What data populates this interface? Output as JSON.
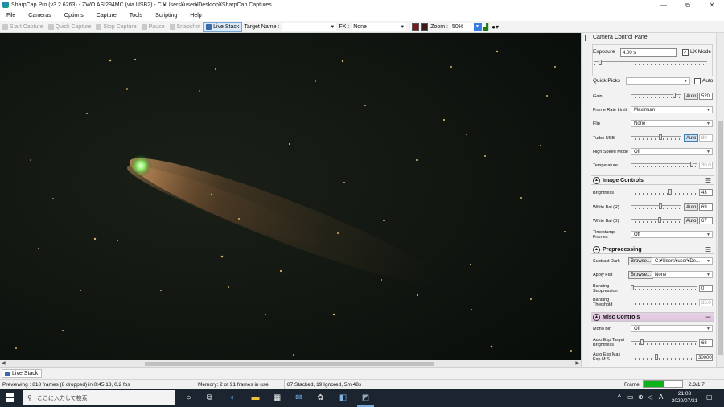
{
  "window": {
    "title": "SharpCap Pro (v3.2.6263) - ZWO ASI294MC (via USB2) - C:¥Users¥user¥Desktop¥SharpCap Captures",
    "minimize": "—",
    "maximize": "⧉",
    "close": "✕"
  },
  "menu": [
    "File",
    "Cameras",
    "Options",
    "Capture",
    "Tools",
    "Scripting",
    "Help"
  ],
  "toolbar": {
    "start_capture": "Start Capture",
    "quick_capture": "Quick Capture",
    "stop_capture": "Stop Capture",
    "pause": "Pause",
    "snapshot": "Snapshot",
    "live_stack": "Live Stack",
    "target_name_label": "Target Name :",
    "target_name_value": "",
    "fx_label": "FX :",
    "fx_value": "None",
    "zoom_label": "Zoom :",
    "zoom_value": "50%",
    "colors": {
      "swatch1": "#7a1a1a",
      "swatch2": "#3a1a1a"
    }
  },
  "panel": {
    "title": "Camera Control Panel",
    "camera_controls": {
      "exposure_label": "Exposure",
      "exposure_value": "4.00 s",
      "lx_mode_label": "LX Mode",
      "lx_mode_checked": "✓",
      "quick_picks_label": "Quick Picks",
      "quick_picks_value": "",
      "auto_label": "Auto",
      "gain_label": "Gain",
      "gain_auto": "Auto",
      "gain_value": "520",
      "frame_rate_label": "Frame Rate Limit",
      "frame_rate_value": "Maximum",
      "flip_label": "Flip",
      "flip_value": "None",
      "turbo_usb_label": "Turbo USB",
      "turbo_usb_auto": "Auto",
      "turbo_usb_value": "80",
      "high_speed_label": "High Speed Mode",
      "high_speed_value": "Off",
      "temperature_label": "Temperature",
      "temperature_value": "30.0"
    },
    "image_controls": {
      "title": "Image Controls",
      "brightness_label": "Brightness",
      "brightness_value": "43",
      "wb_r_label": "White Bal (R)",
      "wb_r_auto": "Auto",
      "wb_r_value": "69",
      "wb_b_label": "White Bal (B)",
      "wb_b_auto": "Auto",
      "wb_b_value": "67",
      "timestamp_label_1": "Timestamp",
      "timestamp_label_2": "Frames",
      "timestamp_value": "Off"
    },
    "preprocessing": {
      "title": "Preprocessing",
      "subtract_dark_label": "Subtract Dark",
      "subtract_dark_browse": "Browse...",
      "subtract_dark_value": "C:¥Users¥user¥De...",
      "apply_flat_label": "Apply Flat",
      "apply_flat_browse": "Browse...",
      "apply_flat_value": "None",
      "banding_supp_label_1": "Banding",
      "banding_supp_label_2": "Suppression",
      "banding_supp_value": "0",
      "banding_thr_label_1": "Banding",
      "banding_thr_label_2": "Threshold",
      "banding_thr_value": "35.0"
    },
    "misc": {
      "title": "Misc Controls",
      "mono_bin_label": "Mono Bin",
      "mono_bin_value": "Off",
      "auto_exp_target_label_1": "Auto Exp Target",
      "auto_exp_target_label_2": "Brightness",
      "auto_exp_target_value": "68",
      "auto_exp_max_label_1": "Auto Exp Max",
      "auto_exp_max_label_2": "Exp M S",
      "auto_exp_max_value": "30000"
    },
    "levels": {
      "exposure": 0.04,
      "gain": 0.9,
      "turbo_usb": 0.6,
      "temperature": 0.95,
      "brightness": 0.6,
      "wb_r": 0.6,
      "wb_b": 0.58,
      "banding_supp": 0.0,
      "auto_exp_target": 0.15,
      "auto_exp_max": 0.4
    }
  },
  "tabs": {
    "live_stack": "Live Stack"
  },
  "status": {
    "previewing": "Previewing : 818 frames (8 dropped) in 0:45:13, 0.2 fps",
    "memory": "Memory: 2 of 91 frames in use.",
    "stacked": "87 Stacked, 19 Ignored, 5m 48s",
    "frame_label": "Frame:",
    "frame_progress": 0.55,
    "frame_counter": "2.3/1.7"
  },
  "taskbar": {
    "search_placeholder": "ここに入力して検索",
    "time": "21:08",
    "date": "2020/07/21",
    "language": "A"
  }
}
